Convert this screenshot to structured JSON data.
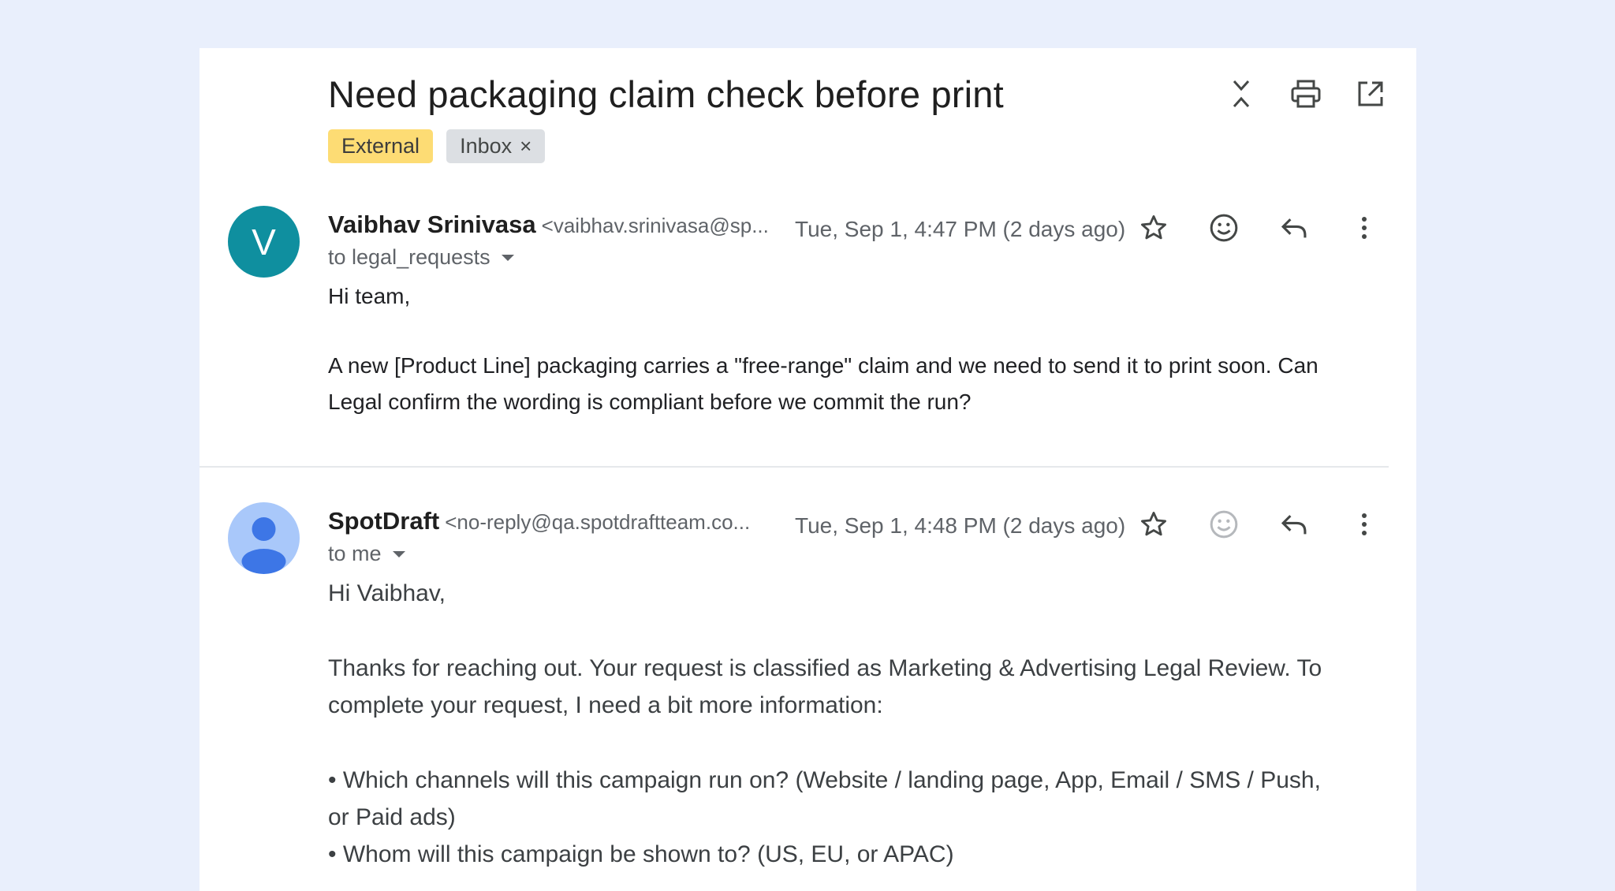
{
  "subject": "Need packaging claim check before print",
  "labels": {
    "external": "External",
    "inbox": "Inbox",
    "remove": "×"
  },
  "messages": [
    {
      "sender_name": "Vaibhav Srinivasa",
      "sender_email": "<vaibhav.srinivasa@sp...",
      "avatar_letter": "V",
      "avatar_color": "#0f8f9f",
      "date": "Tue, Sep 1, 4:47 PM (2 days ago)",
      "recipient": "to legal_requests",
      "body": {
        "greeting": "Hi team,",
        "para1_line1": "A new [Product Line] packaging carries a \"free-range\" claim and we need to send it to print soon. Can",
        "para1_line2": "Legal confirm the wording is compliant before we commit the run?"
      }
    },
    {
      "sender_name": "SpotDraft",
      "sender_email": "<no-reply@qa.spotdraftteam.co...",
      "avatar_icon": "person-icon",
      "date": "Tue, Sep 1, 4:48 PM (2 days ago)",
      "recipient": "to me",
      "body": {
        "greeting": "Hi Vaibhav,",
        "para1_line1": "Thanks for reaching out. Your request is classified as Marketing & Advertising Legal Review. To",
        "para1_line2": "complete your request, I need a bit more information:",
        "bullet1_line1": "• Which channels will this campaign run on? (Website / landing page, App, Email / SMS / Push,",
        "bullet1_line2": "or Paid ads)",
        "bullet2": "• Whom will this campaign be shown to? (US, EU, or APAC)"
      }
    }
  ],
  "colors": {
    "page_bg": "#e9effc",
    "external_label": "#fddc74",
    "inbox_label": "#dcdfe3",
    "avatar_v": "#0f8f9f",
    "avatar_default": "#a9c8fa"
  }
}
